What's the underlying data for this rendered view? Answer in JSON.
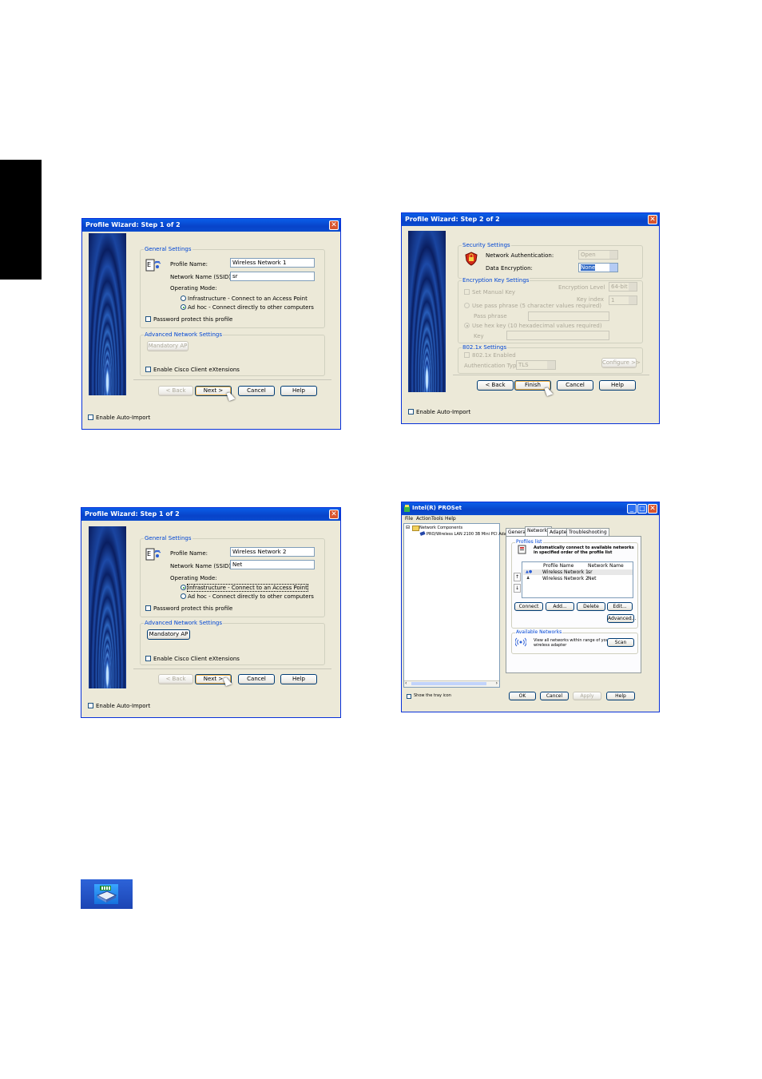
{
  "wizard1": {
    "title": "Profile Wizard: Step 1 of 2",
    "general_settings": "General Settings",
    "profile_name_label": "Profile Name:",
    "profile_name_value": "Wireless Network 1",
    "ssid_label": "Network Name (SSID):",
    "ssid_value": "sr",
    "operating_mode_label": "Operating Mode:",
    "mode_infrastructure": "Infrastructure - Connect to an Access Point",
    "mode_adhoc": "Ad hoc - Connect directly to other computers",
    "password_protect": "Password protect this profile",
    "advanced_settings": "Advanced Network Settings",
    "mandatory_ap": "Mandatory AP",
    "cisco": "Enable Cisco Client eXtensions",
    "back": "< Back",
    "next": "Next >",
    "cancel": "Cancel",
    "help": "Help",
    "auto_import": "Enable Auto-Import"
  },
  "wizard2": {
    "title": "Profile Wizard: Step 2 of 2",
    "security_settings": "Security Settings",
    "net_auth_label": "Network Authentication:",
    "net_auth_value": "Open",
    "data_enc_label": "Data Encryption:",
    "data_enc_value": "None",
    "enc_key_settings": "Encryption Key Settings",
    "enc_level_label": "Encryption Level",
    "enc_level_value": "64-bit",
    "set_manual_key": "Set Manual Key",
    "key_index_label": "Key index",
    "key_index_value": "1",
    "use_pass_phrase": "Use pass phrase (5 character values required)",
    "pass_phrase_label": "Pass phrase",
    "use_hex_key": "Use hex key (10 hexadecimal values required)",
    "key_label": "Key",
    "x8021_settings": "802.1x Settings",
    "x8021_enabled": "802.1x Enabled",
    "auth_type_label": "Authentication Type",
    "auth_type_value": "TLS",
    "configure": "Configure >>",
    "back": "< Back",
    "finish": "Finish",
    "cancel": "Cancel",
    "help": "Help",
    "auto_import": "Enable Auto-Import"
  },
  "wizard3": {
    "title": "Profile Wizard: Step 1 of 2",
    "general_settings": "General Settings",
    "profile_name_label": "Profile Name:",
    "profile_name_value": "Wireless Network 2",
    "ssid_label": "Network Name (SSID):",
    "ssid_value": "Net",
    "operating_mode_label": "Operating Mode:",
    "mode_infrastructure": "Infrastructure - Connect to an Access Point",
    "mode_adhoc": "Ad hoc - Connect directly to other computers",
    "password_protect": "Password protect this profile",
    "advanced_settings": "Advanced Network Settings",
    "mandatory_ap": "Mandatory AP",
    "cisco": "Enable Cisco Client eXtensions",
    "back": "< Back",
    "next": "Next >",
    "cancel": "Cancel",
    "help": "Help",
    "auto_import": "Enable Auto-Import"
  },
  "proset": {
    "title": "Intel(R) PROSet",
    "menu": [
      "File",
      "Action",
      "Tools",
      "Help"
    ],
    "tree_root": "Network Components",
    "tree_child": "PRO/Wireless LAN 2100 3B Mini PCI Ada",
    "tabs": [
      "General",
      "Networks",
      "Adapter",
      "Troubleshooting"
    ],
    "profiles_list": "Profiles list",
    "auto_connect_line1": "Automatically connect to available networks",
    "auto_connect_line2": "in specified order of the profile list",
    "col_profile": "Profile Name",
    "col_network": "Network Name",
    "rows": [
      {
        "profile": "Wireless Network 1",
        "network": "sr"
      },
      {
        "profile": "Wireless Network 2",
        "network": "Net"
      }
    ],
    "connect": "Connect",
    "add": "Add...",
    "delete": "Delete",
    "edit": "Edit...",
    "advanced": "Advanced...",
    "available_networks": "Available Networks",
    "view_all_line1": "View all networks within range of your",
    "view_all_line2": "wireless adapter",
    "scan": "Scan",
    "show_tray": "Show the tray icon",
    "ok": "OK",
    "cancel": "Cancel",
    "apply": "Apply",
    "help": "Help"
  }
}
